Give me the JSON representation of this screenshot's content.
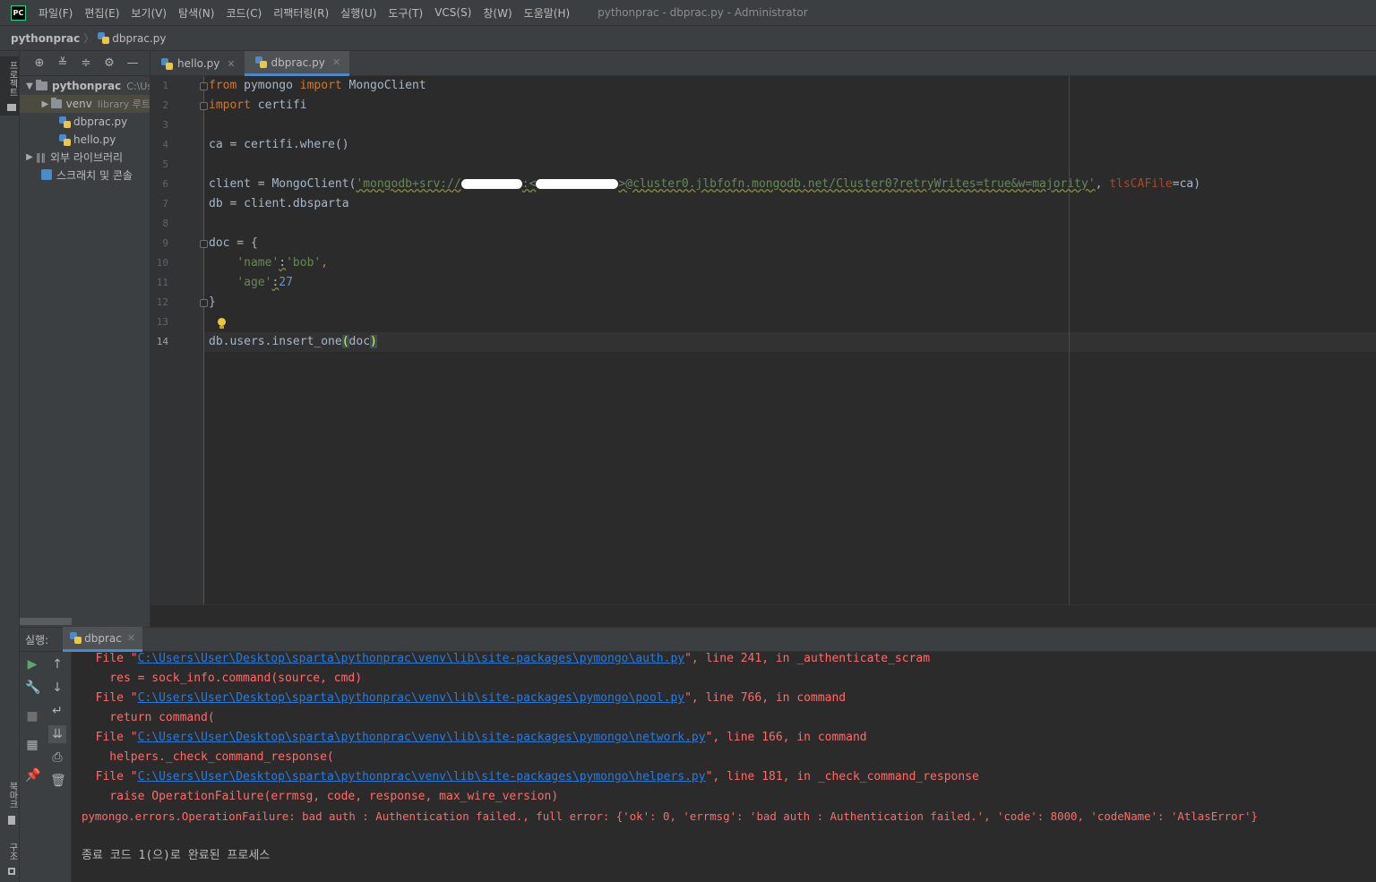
{
  "app": {
    "logo_text": "PC",
    "window_title": "pythonprac - dbprac.py - Administrator"
  },
  "menu": [
    "파일(F)",
    "편집(E)",
    "보기(V)",
    "탐색(N)",
    "코드(C)",
    "리팩터링(R)",
    "실행(U)",
    "도구(T)",
    "VCS(S)",
    "창(W)",
    "도움말(H)"
  ],
  "breadcrumb": {
    "project": "pythonprac",
    "file": "dbprac.py"
  },
  "left_stripe": {
    "project_label": "프로젝트",
    "bookmarks_label": "북마크",
    "structure_label": "구조"
  },
  "project_tree": {
    "root": {
      "name": "pythonprac",
      "path": "C:\\Us"
    },
    "venv": {
      "name": "venv",
      "hint": "library 루트"
    },
    "files": [
      "dbprac.py",
      "hello.py"
    ],
    "external_libs": "외부 라이브러리",
    "scratches": "스크래치 및 콘솔"
  },
  "editor_tabs": [
    {
      "label": "hello.py",
      "active": false
    },
    {
      "label": "dbprac.py",
      "active": true
    }
  ],
  "code": {
    "line_numbers": [
      "1",
      "2",
      "3",
      "4",
      "5",
      "6",
      "7",
      "8",
      "9",
      "10",
      "11",
      "12",
      "13",
      "14"
    ],
    "current_line": "14",
    "l1": {
      "kw1": "from",
      "mod": " pymongo ",
      "kw2": "import",
      "name": " MongoClient"
    },
    "l2": {
      "kw": "import",
      "name": " certifi"
    },
    "l4": "ca = certifi.where()",
    "l6": {
      "prefix": "client = MongoClient(",
      "str_a": "'mongodb+srv://",
      "str_b": ":<",
      "str_c": ">@cluster0.jlbfofn.mongodb.net/Cluster0?retryWrites=true&w=majority'",
      "comma": ", ",
      "kwarg": "tlsCAFile",
      "suffix": "=ca)"
    },
    "l7": "db = client.dbsparta",
    "l9": "doc = {",
    "l10": {
      "indent": "    ",
      "key": "'name'",
      "colon": ":",
      "val": "'bob'",
      "comma": ","
    },
    "l11": {
      "indent": "    ",
      "key": "'age'",
      "colon": ":",
      "val": "27"
    },
    "l12": "}",
    "l14": {
      "prefix": "db.users.insert_one",
      "open": "(",
      "arg": "doc",
      "close": ")"
    }
  },
  "run": {
    "label": "실행:",
    "tab": "dbprac",
    "console": [
      {
        "pre": "  File \"",
        "link": "C:\\Users\\User\\Desktop\\sparta\\pythonprac\\venv\\lib\\site-packages\\pymongo\\auth.py",
        "post": "\", line 241, in _authenticate_scram"
      },
      {
        "text": "    res = sock_info.command(source, cmd)"
      },
      {
        "pre": "  File \"",
        "link": "C:\\Users\\User\\Desktop\\sparta\\pythonprac\\venv\\lib\\site-packages\\pymongo\\pool.py",
        "post": "\", line 766, in command"
      },
      {
        "text": "    return command("
      },
      {
        "pre": "  File \"",
        "link": "C:\\Users\\User\\Desktop\\sparta\\pythonprac\\venv\\lib\\site-packages\\pymongo\\network.py",
        "post": "\", line 166, in command"
      },
      {
        "text": "    helpers._check_command_response("
      },
      {
        "pre": "  File \"",
        "link": "C:\\Users\\User\\Desktop\\sparta\\pythonprac\\venv\\lib\\site-packages\\pymongo\\helpers.py",
        "post": "\", line 181, in _check_command_response"
      },
      {
        "text": "    raise OperationFailure(errmsg, code, response, max_wire_version)"
      },
      {
        "text": "pymongo.errors.OperationFailure: bad auth : Authentication failed., full error: {'ok': 0, 'errmsg': 'bad auth : Authentication failed.', 'code': 8000, 'codeName': 'AtlasError'}"
      },
      {
        "text": ""
      },
      {
        "text": "종료 코드 1(으)로 완료된 프로세스"
      }
    ]
  },
  "colors": {
    "keyword": "#cc7832",
    "string": "#6a8759",
    "number": "#6897bb",
    "error": "#ff6b68",
    "link": "#287bde",
    "accent": "#4a88c7"
  }
}
